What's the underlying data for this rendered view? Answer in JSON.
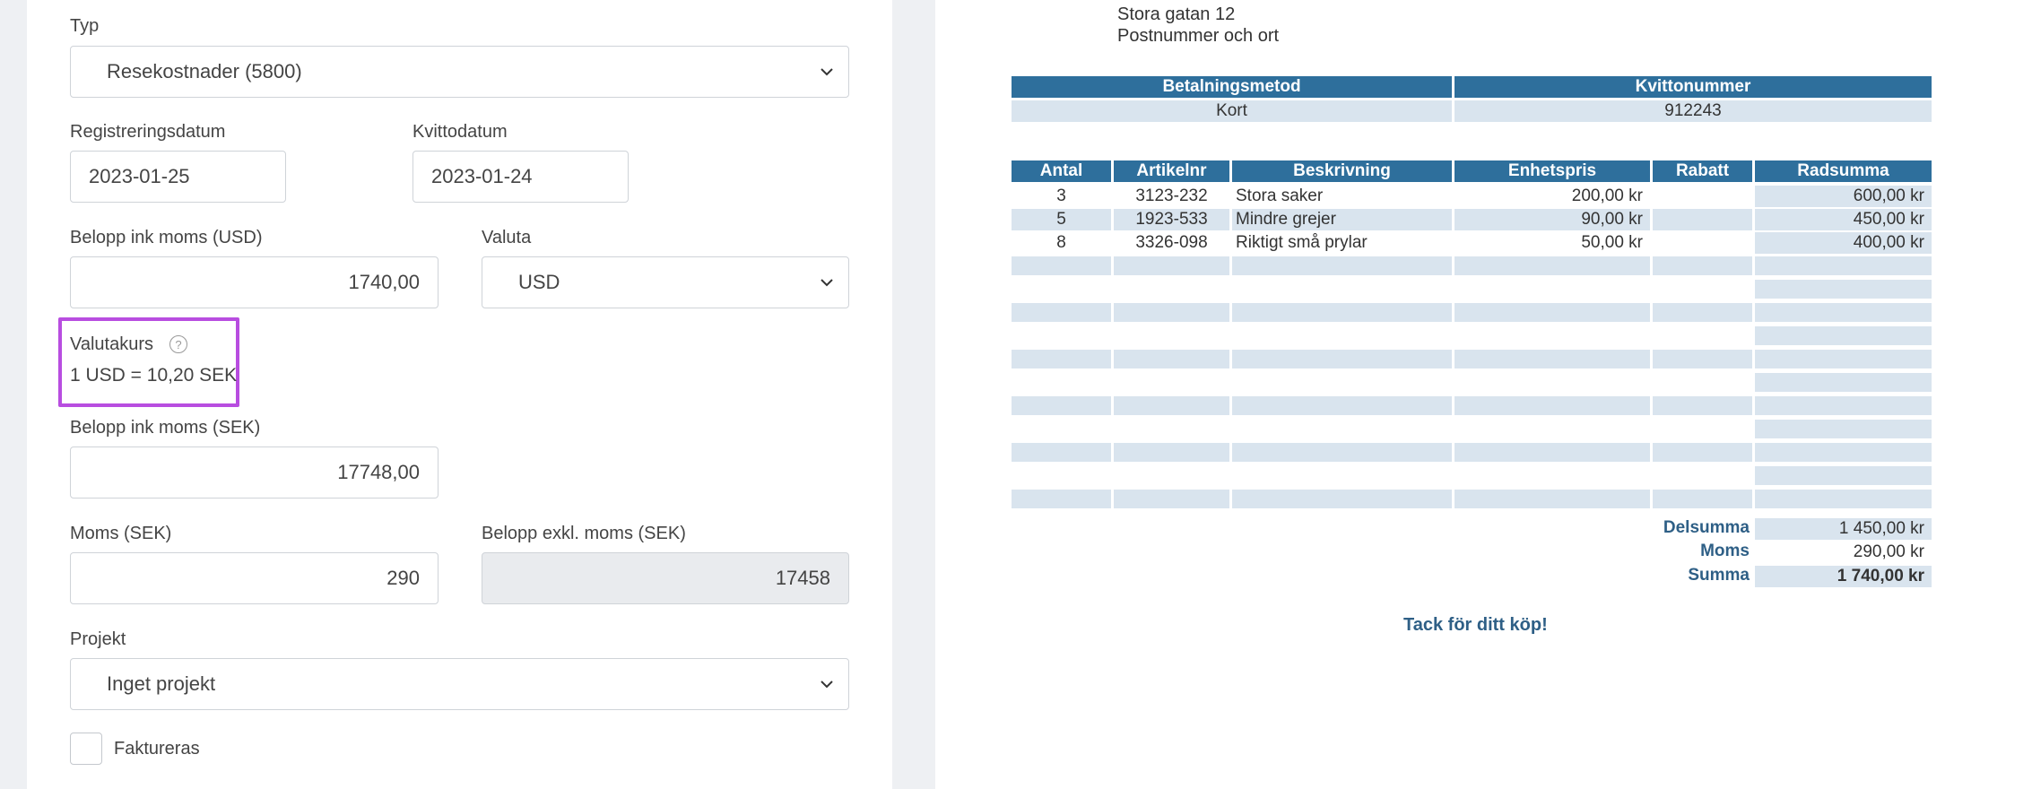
{
  "form": {
    "typ_label": "Typ",
    "typ_value": "Resekostnader (5800)",
    "registreringsdatum_label": "Registreringsdatum",
    "registreringsdatum_value": "2023-01-25",
    "kvittodatum_label": "Kvittodatum",
    "kvittodatum_value": "2023-01-24",
    "belopp_usd_label": "Belopp ink moms (USD)",
    "belopp_usd_value": "1740,00",
    "valuta_label": "Valuta",
    "valuta_value": "USD",
    "valutakurs_label": "Valutakurs",
    "valutakurs_help": "?",
    "valutakurs_value": "1 USD = 10,20 SEK",
    "belopp_sek_label": "Belopp ink moms (SEK)",
    "belopp_sek_value": "17748,00",
    "moms_label": "Moms (SEK)",
    "moms_value": "290",
    "belopp_exkl_label": "Belopp exkl. moms (SEK)",
    "belopp_exkl_value": "17458",
    "projekt_label": "Projekt",
    "projekt_value": "Inget projekt",
    "faktureras_label": "Faktureras"
  },
  "receipt": {
    "address_line1": "Stora gatan 12",
    "address_line2": "Postnummer och ort",
    "payment_header": "Betalningsmetod",
    "receipt_no_header": "Kvittonummer",
    "payment_value": "Kort",
    "receipt_no_value": "912243",
    "columns": [
      "Antal",
      "Artikelnr",
      "Beskrivning",
      "Enhetspris",
      "Rabatt",
      "Radsumma"
    ],
    "rows": [
      {
        "antal": "3",
        "artikelnr": "3123-232",
        "beskrivning": "Stora saker",
        "enhetspris": "200,00 kr",
        "rabatt": "",
        "radsumma": "600,00 kr"
      },
      {
        "antal": "5",
        "artikelnr": "1923-533",
        "beskrivning": "Mindre grejer",
        "enhetspris": "90,00 kr",
        "rabatt": "",
        "radsumma": "450,00 kr"
      },
      {
        "antal": "8",
        "artikelnr": "3326-098",
        "beskrivning": "Riktigt små prylar",
        "enhetspris": "50,00 kr",
        "rabatt": "",
        "radsumma": "400,00 kr"
      }
    ],
    "delsumma_label": "Delsumma",
    "delsumma_value": "1 450,00 kr",
    "moms_label": "Moms",
    "moms_value": "290,00 kr",
    "summa_label": "Summa",
    "summa_value": "1 740,00 kr",
    "thanks": "Tack för ditt köp!"
  },
  "colors": {
    "header_blue": "#2e6f9c",
    "cell_blue": "#d9e4ee",
    "highlight": "#b84de0",
    "total_text": "#2e5f86"
  }
}
